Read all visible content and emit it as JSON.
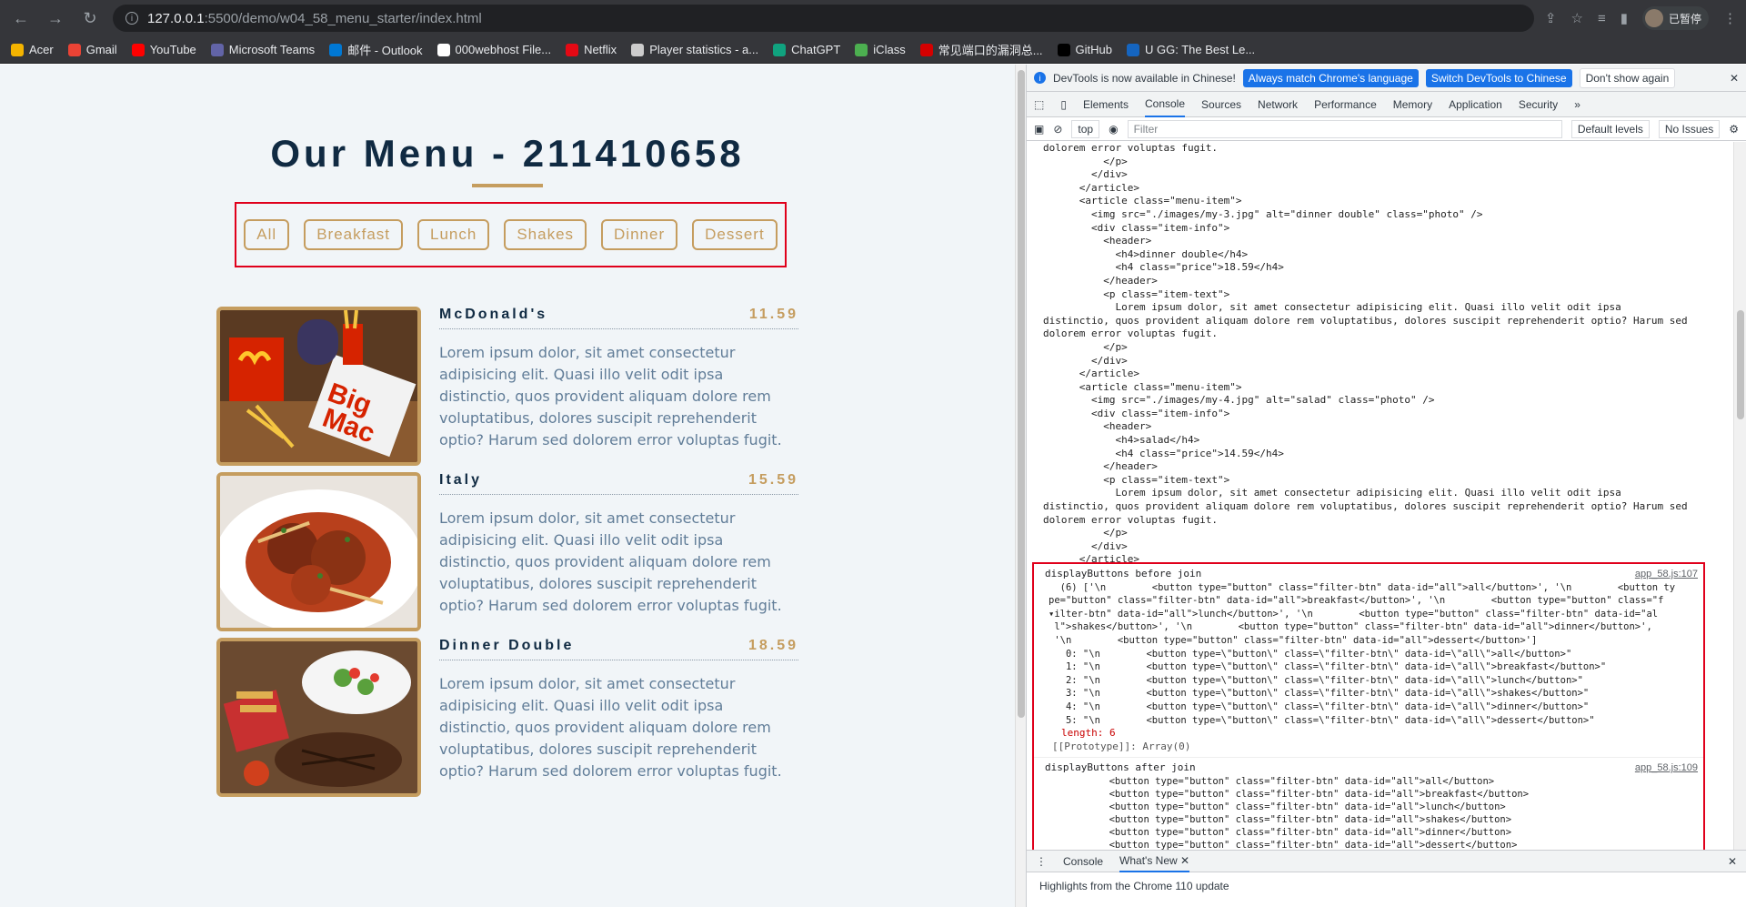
{
  "browser": {
    "url_host": "127.0.0.1",
    "url_path": ":5500/demo/w04_58_menu_starter/index.html",
    "profile_label": "已暂停",
    "bookmarks": [
      {
        "label": "Acer",
        "color": "#f4b400"
      },
      {
        "label": "Gmail",
        "color": "#ea4335"
      },
      {
        "label": "YouTube",
        "color": "#ff0000"
      },
      {
        "label": "Microsoft Teams",
        "color": "#6264a7"
      },
      {
        "label": "邮件 - Outlook",
        "color": "#0078d4"
      },
      {
        "label": "000webhost File...",
        "color": "#ffffff"
      },
      {
        "label": "Netflix",
        "color": "#e50914"
      },
      {
        "label": "Player statistics - a...",
        "color": "#cccccc"
      },
      {
        "label": "ChatGPT",
        "color": "#10a37f"
      },
      {
        "label": "iClass",
        "color": "#4caf50"
      },
      {
        "label": "常见端口的漏洞总...",
        "color": "#d50000"
      },
      {
        "label": "GitHub",
        "color": "#000000"
      },
      {
        "label": "U GG: The Best Le...",
        "color": "#1565c0"
      }
    ]
  },
  "page": {
    "title": "Our Menu - 211410658",
    "filters": [
      "All",
      "Breakfast",
      "Lunch",
      "Shakes",
      "Dinner",
      "Dessert"
    ],
    "items": [
      {
        "name": "McDonald's",
        "price": "11.59",
        "text": "Lorem ipsum dolor, sit amet consectetur adipisicing elit. Quasi illo velit odit ipsa distinctio, quos provident aliquam dolore rem voluptatibus, dolores suscipit reprehenderit optio? Harum sed dolorem error voluptas fugit."
      },
      {
        "name": "Italy",
        "price": "15.59",
        "text": "Lorem ipsum dolor, sit amet consectetur adipisicing elit. Quasi illo velit odit ipsa distinctio, quos provident aliquam dolore rem voluptatibus, dolores suscipit reprehenderit optio? Harum sed dolorem error voluptas fugit."
      },
      {
        "name": "Dinner Double",
        "price": "18.59",
        "text": "Lorem ipsum dolor, sit amet consectetur adipisicing elit. Quasi illo velit odit ipsa distinctio, quos provident aliquam dolore rem voluptatibus, dolores suscipit reprehenderit optio? Harum sed dolorem error voluptas fugit."
      }
    ]
  },
  "devtools": {
    "banner_text": "DevTools is now available in Chinese!",
    "banner_btn1": "Always match Chrome's language",
    "banner_btn2": "Switch DevTools to Chinese",
    "banner_btn3": "Don't show again",
    "tabs": [
      "Elements",
      "Console",
      "Sources",
      "Network",
      "Performance",
      "Memory",
      "Application",
      "Security"
    ],
    "context": "top",
    "filter_placeholder": "Filter",
    "levels": "Default levels",
    "issues": "No Issues",
    "log1_label": "displayButtons before join",
    "log1_src": "app_58.js:107",
    "log2_label": "displayButtons after join",
    "log2_src": "app_58.js:109",
    "array_length": "length: 6",
    "array_proto": "[[Prototype]]: Array(0)",
    "drawer_tab1": "Console",
    "drawer_tab2": "What's New",
    "drawer_text": "Highlights from the Chrome 110 update"
  }
}
